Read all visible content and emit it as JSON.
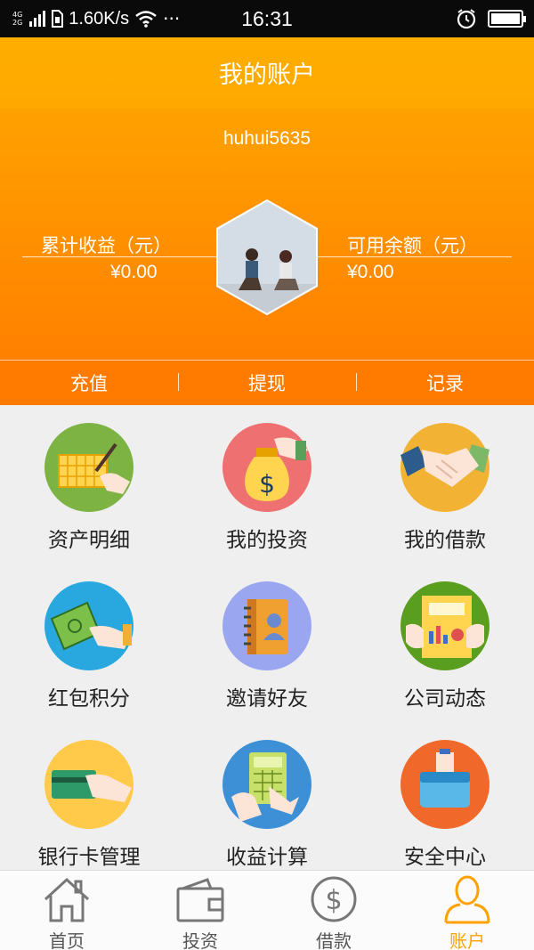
{
  "status_bar": {
    "network": [
      "4G",
      "2G"
    ],
    "speed": "1.60K/s",
    "more": "···",
    "time": "16:31"
  },
  "header": {
    "title": "我的账户",
    "username": "huhui5635",
    "left_stat": {
      "label": "累计收益（元）",
      "value": "¥0.00"
    },
    "right_stat": {
      "label": "可用余额（元）",
      "value": "¥0.00"
    }
  },
  "actions": [
    {
      "label": "充值"
    },
    {
      "label": "提现"
    },
    {
      "label": "记录"
    }
  ],
  "menu": [
    {
      "label": "资产明细",
      "icon": "asset-detail-icon",
      "color": "#7cb342"
    },
    {
      "label": "我的投资",
      "icon": "money-bag-icon",
      "color": "#ef7070"
    },
    {
      "label": "我的借款",
      "icon": "handshake-icon",
      "color": "#f2b233"
    },
    {
      "label": "红包积分",
      "icon": "cash-icon",
      "color": "#29a8e0"
    },
    {
      "label": "邀请好友",
      "icon": "contact-book-icon",
      "color": "#9aa7f0"
    },
    {
      "label": "公司动态",
      "icon": "chart-doc-icon",
      "color": "#5a9e1f"
    },
    {
      "label": "银行卡管理",
      "icon": "bank-card-icon",
      "color": "#ffc94a"
    },
    {
      "label": "收益计算",
      "icon": "calculator-icon",
      "color": "#3d8fd6"
    },
    {
      "label": "安全中心",
      "icon": "briefcase-icon",
      "color": "#f0692a"
    }
  ],
  "tabs": [
    {
      "label": "首页",
      "icon": "home-icon"
    },
    {
      "label": "投资",
      "icon": "wallet-icon"
    },
    {
      "label": "借款",
      "icon": "dollar-coin-icon"
    },
    {
      "label": "账户",
      "icon": "user-icon",
      "active": true
    }
  ],
  "colors": {
    "brand_orange": "#ff9000",
    "tab_active": "#ffa200"
  }
}
